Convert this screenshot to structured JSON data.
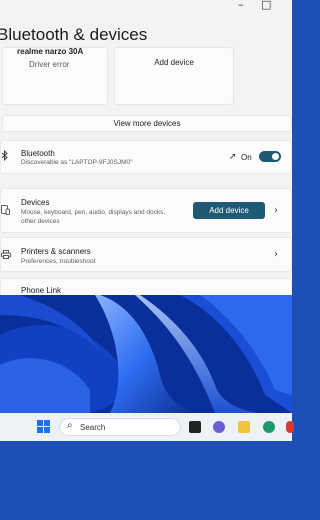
{
  "window": {
    "title": "Bluetooth & devices",
    "controls": {
      "minimize": "–",
      "maximize": "□"
    }
  },
  "device_cards": [
    {
      "name": "realme narzo 30A",
      "status": "Driver error"
    },
    {
      "label": "Add device"
    }
  ],
  "view_more_label": "View more devices",
  "bluetooth": {
    "title": "Bluetooth",
    "subtitle": "Discoverable as \"LAPTOP-9FJ0SJM0\"",
    "state_label": "On",
    "icon": "bluetooth-icon"
  },
  "devices": {
    "title": "Devices",
    "subtitle_line1": "Mouse, keyboard, pen, audio, displays and docks,",
    "subtitle_line2": "other devices",
    "button_label": "Add device",
    "icon": "devices-icon"
  },
  "printers": {
    "title": "Printers & scanners",
    "subtitle": "Preferences, troubleshoot",
    "icon": "printer-icon"
  },
  "phone_link": {
    "title": "Phone Link"
  },
  "taskbar": {
    "search_placeholder": "Search",
    "icons": [
      "windows-start-icon",
      "search-icon",
      "task-view-icon",
      "teams-chat-icon",
      "file-explorer-icon",
      "edge-icon",
      "chrome-icon"
    ]
  },
  "colors": {
    "accent": "#1f5a75",
    "wallpaper": "#0b2f9a",
    "backdrop": "#1d4fb5"
  }
}
